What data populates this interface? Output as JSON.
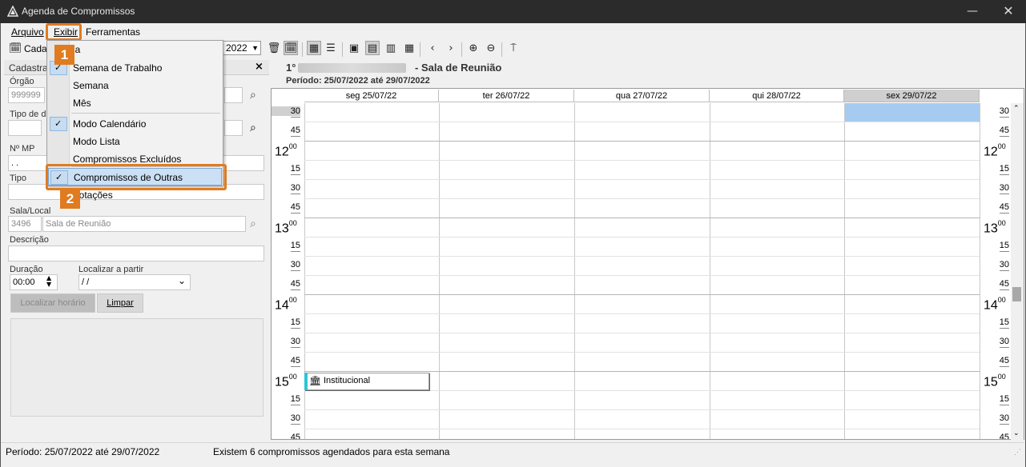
{
  "window": {
    "title": "Agenda de Compromissos"
  },
  "menu": {
    "arquivo": "Arquivo",
    "exibir": "Exibir",
    "ferramentas": "Ferramentas"
  },
  "toolbar": {
    "cadastro_label": "Cadas",
    "date_value": "2022"
  },
  "dropdown": {
    "items": [
      {
        "label": "ia",
        "checked": false
      },
      {
        "label": "Semana de Trabalho",
        "checked": true
      },
      {
        "label": "Semana",
        "checked": false
      },
      {
        "label": "Mês",
        "checked": false
      },
      {
        "label": "Modo Calendário",
        "checked": true
      },
      {
        "label": "Modo Lista",
        "checked": false
      },
      {
        "label": "Compromissos Excluídos",
        "checked": false
      },
      {
        "label": "Compromissos de Outras Lotações",
        "checked": true
      }
    ]
  },
  "badges": {
    "one": "1",
    "two": "2"
  },
  "left_panel": {
    "title": "Cadastra",
    "orgao_label": "Órgão",
    "orgao_value": "999999",
    "tipo_de_label": "Tipo de d",
    "nmp_label": "Nº MP",
    "nmp_value": ".   .",
    "tipo_label": "Tipo",
    "sala_label": "Sala/Local",
    "sala_code": "3496",
    "sala_name": "Sala de Reunião",
    "descricao_label": "Descrição",
    "duracao_label": "Duração",
    "duracao_value": "00:00",
    "localizar_partir_label": "Localizar a partir",
    "localizar_partir_value": " / /",
    "btn_localizar": "Localizar horário",
    "btn_limpar": "Limpar"
  },
  "calendar": {
    "title_prefix": "1°",
    "title_suffix": "- Sala de Reunião",
    "period": "Período: 25/07/2022 até 29/07/2022",
    "days": [
      "seg 25/07/22",
      "ter 26/07/22",
      "qua 27/07/22",
      "qui 28/07/22",
      "sex 29/07/22"
    ],
    "selected_day_index": 4,
    "appointment": "Institucional",
    "hours": [
      "12",
      "13",
      "14",
      "15"
    ],
    "hour_sup": "00",
    "quarters": [
      "15",
      "30",
      "45"
    ],
    "first_slots": [
      "30",
      "45"
    ]
  },
  "status": {
    "period": "Período: 25/07/2022 até 29/07/2022",
    "message": "Existem 6 compromissos agendados para esta semana"
  },
  "colors": {
    "accent_orange": "#e07b20",
    "highlight_blue": "#a6cbf0",
    "appt_bar": "#2ec4d8"
  }
}
